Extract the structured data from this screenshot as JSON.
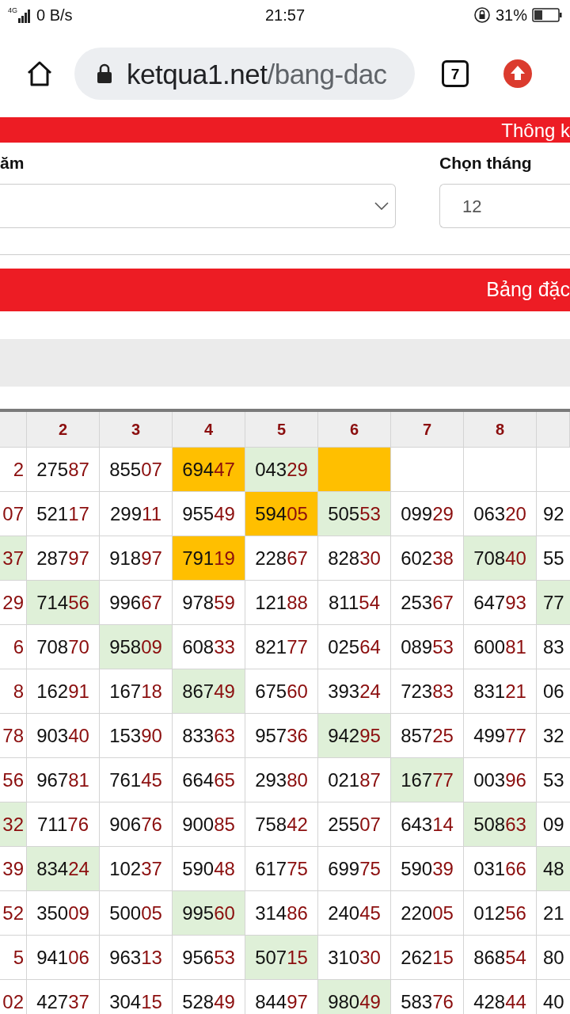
{
  "status_bar": {
    "network": "4G",
    "speed": "0 B/s",
    "time": "21:57",
    "battery": "31%"
  },
  "browser": {
    "url_host": "ketqua1.net",
    "url_path": "/bang-dac",
    "tab_count": "7"
  },
  "top_banner": {
    "title": "Thông k"
  },
  "filters": [
    {
      "kind": "select",
      "label": "ăm"
    },
    {
      "kind": "input",
      "label": "Chọn tháng",
      "value": "12"
    }
  ],
  "section_banner": {
    "title": "Bảng đặc"
  },
  "table": {
    "columns": [
      "",
      "2",
      "3",
      "4",
      "5",
      "6",
      "7",
      "8",
      ""
    ],
    "rows": [
      [
        {
          "tail": "2"
        },
        {
          "head": "275",
          "tail": "87"
        },
        {
          "head": "855",
          "tail": "07"
        },
        {
          "head": "694",
          "tail": "47",
          "color": "#ffbf00"
        },
        {
          "head": "043",
          "tail": "29",
          "color": "#dff0d8"
        },
        {
          "color": "#ffbf00"
        },
        {},
        {},
        {}
      ],
      [
        {
          "tail": "07"
        },
        {
          "head": "521",
          "tail": "17"
        },
        {
          "head": "299",
          "tail": "11"
        },
        {
          "head": "955",
          "tail": "49"
        },
        {
          "head": "594",
          "tail": "05",
          "color": "#ffbf00"
        },
        {
          "head": "505",
          "tail": "53",
          "color": "#dff0d8"
        },
        {
          "head": "099",
          "tail": "29"
        },
        {
          "head": "063",
          "tail": "20"
        },
        {
          "head": "92"
        }
      ],
      [
        {
          "tail": "37",
          "color": "#dff0d8"
        },
        {
          "head": "287",
          "tail": "97"
        },
        {
          "head": "918",
          "tail": "97"
        },
        {
          "head": "791",
          "tail": "19",
          "color": "#ffbf00"
        },
        {
          "head": "228",
          "tail": "67"
        },
        {
          "head": "828",
          "tail": "30"
        },
        {
          "head": "602",
          "tail": "38"
        },
        {
          "head": "708",
          "tail": "40",
          "color": "#dff0d8"
        },
        {
          "head": "55"
        }
      ],
      [
        {
          "tail": "29"
        },
        {
          "head": "714",
          "tail": "56",
          "color": "#dff0d8"
        },
        {
          "head": "996",
          "tail": "67"
        },
        {
          "head": "978",
          "tail": "59"
        },
        {
          "head": "121",
          "tail": "88"
        },
        {
          "head": "811",
          "tail": "54"
        },
        {
          "head": "253",
          "tail": "67"
        },
        {
          "head": "647",
          "tail": "93"
        },
        {
          "head": "77",
          "color": "#dff0d8"
        }
      ],
      [
        {
          "tail": "6"
        },
        {
          "head": "708",
          "tail": "70"
        },
        {
          "head": "958",
          "tail": "09",
          "color": "#dff0d8"
        },
        {
          "head": "608",
          "tail": "33"
        },
        {
          "head": "821",
          "tail": "77"
        },
        {
          "head": "025",
          "tail": "64"
        },
        {
          "head": "089",
          "tail": "53"
        },
        {
          "head": "600",
          "tail": "81"
        },
        {
          "head": "83"
        }
      ],
      [
        {
          "tail": "8"
        },
        {
          "head": "162",
          "tail": "91"
        },
        {
          "head": "167",
          "tail": "18"
        },
        {
          "head": "867",
          "tail": "49",
          "color": "#dff0d8"
        },
        {
          "head": "675",
          "tail": "60"
        },
        {
          "head": "393",
          "tail": "24"
        },
        {
          "head": "723",
          "tail": "83"
        },
        {
          "head": "831",
          "tail": "21"
        },
        {
          "head": "06"
        }
      ],
      [
        {
          "tail": "78"
        },
        {
          "head": "903",
          "tail": "40"
        },
        {
          "head": "153",
          "tail": "90"
        },
        {
          "head": "833",
          "tail": "63"
        },
        {
          "head": "957",
          "tail": "36"
        },
        {
          "head": "942",
          "tail": "95",
          "color": "#dff0d8"
        },
        {
          "head": "857",
          "tail": "25"
        },
        {
          "head": "499",
          "tail": "77"
        },
        {
          "head": "32"
        }
      ],
      [
        {
          "tail": "56"
        },
        {
          "head": "967",
          "tail": "81"
        },
        {
          "head": "761",
          "tail": "45"
        },
        {
          "head": "664",
          "tail": "65"
        },
        {
          "head": "293",
          "tail": "80"
        },
        {
          "head": "021",
          "tail": "87"
        },
        {
          "head": "167",
          "tail": "77",
          "color": "#dff0d8"
        },
        {
          "head": "003",
          "tail": "96"
        },
        {
          "head": "53"
        }
      ],
      [
        {
          "tail": "32",
          "color": "#dff0d8"
        },
        {
          "head": "711",
          "tail": "76"
        },
        {
          "head": "906",
          "tail": "76"
        },
        {
          "head": "900",
          "tail": "85"
        },
        {
          "head": "758",
          "tail": "42"
        },
        {
          "head": "255",
          "tail": "07"
        },
        {
          "head": "643",
          "tail": "14"
        },
        {
          "head": "508",
          "tail": "63",
          "color": "#dff0d8"
        },
        {
          "head": "09"
        }
      ],
      [
        {
          "tail": "39"
        },
        {
          "head": "834",
          "tail": "24",
          "color": "#dff0d8"
        },
        {
          "head": "102",
          "tail": "37"
        },
        {
          "head": "590",
          "tail": "48"
        },
        {
          "head": "617",
          "tail": "75"
        },
        {
          "head": "699",
          "tail": "75"
        },
        {
          "head": "590",
          "tail": "39"
        },
        {
          "head": "031",
          "tail": "66"
        },
        {
          "head": "48",
          "color": "#dff0d8"
        }
      ],
      [
        {
          "tail": "52"
        },
        {
          "head": "350",
          "tail": "09"
        },
        {
          "head": "500",
          "tail": "05"
        },
        {
          "head": "995",
          "tail": "60",
          "color": "#dff0d8"
        },
        {
          "head": "314",
          "tail": "86"
        },
        {
          "head": "240",
          "tail": "45"
        },
        {
          "head": "220",
          "tail": "05"
        },
        {
          "head": "012",
          "tail": "56"
        },
        {
          "head": "21"
        }
      ],
      [
        {
          "tail": "5"
        },
        {
          "head": "941",
          "tail": "06"
        },
        {
          "head": "963",
          "tail": "13"
        },
        {
          "head": "956",
          "tail": "53"
        },
        {
          "head": "507",
          "tail": "15",
          "color": "#dff0d8"
        },
        {
          "head": "310",
          "tail": "30"
        },
        {
          "head": "262",
          "tail": "15"
        },
        {
          "head": "868",
          "tail": "54"
        },
        {
          "head": "80"
        }
      ],
      [
        {
          "tail": "02"
        },
        {
          "head": "427",
          "tail": "37"
        },
        {
          "head": "304",
          "tail": "15"
        },
        {
          "head": "528",
          "tail": "49"
        },
        {
          "head": "844",
          "tail": "97"
        },
        {
          "head": "980",
          "tail": "49",
          "color": "#dff0d8"
        },
        {
          "head": "583",
          "tail": "76"
        },
        {
          "head": "428",
          "tail": "44"
        },
        {
          "head": "40"
        }
      ]
    ]
  }
}
